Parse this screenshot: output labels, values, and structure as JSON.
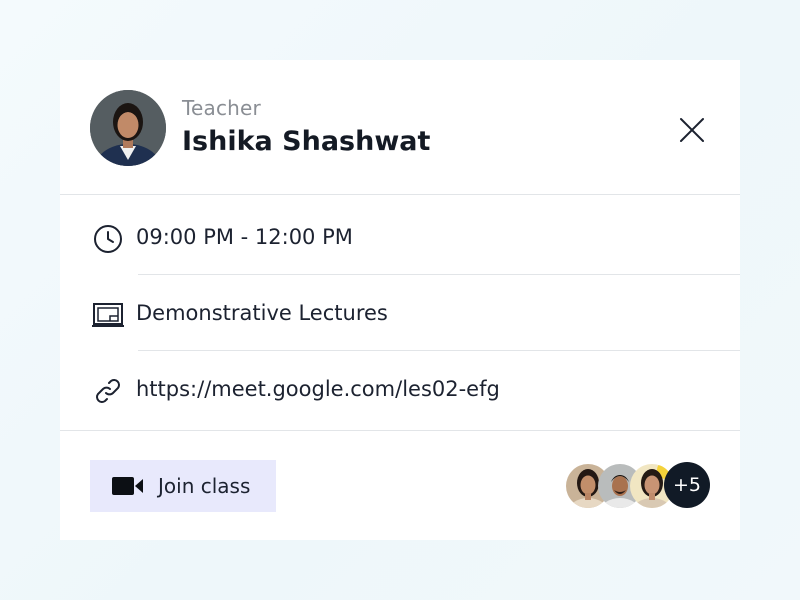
{
  "teacher": {
    "role": "Teacher",
    "name": "Ishika Shashwat",
    "avatar_icon": "teacher-avatar"
  },
  "close": {
    "icon": "close-icon"
  },
  "details": {
    "time": {
      "icon": "clock-icon",
      "text": "09:00 PM - 12:00 PM"
    },
    "class_type": {
      "icon": "board-icon",
      "text": "Demonstrative Lectures"
    },
    "link": {
      "icon": "link-icon",
      "text": "https://meet.google.com/les02-efg"
    }
  },
  "footer": {
    "join_button": {
      "icon": "video-camera-icon",
      "label": "Join class"
    },
    "participants": {
      "avatars": [
        "participant-avatar-1",
        "participant-avatar-2",
        "participant-avatar-3"
      ],
      "more_count": "+5"
    }
  },
  "colors": {
    "join_button_bg": "#e8e9fc",
    "badge_bg": "#111a26",
    "text_primary": "#141a24",
    "text_muted": "#8a8e94"
  }
}
